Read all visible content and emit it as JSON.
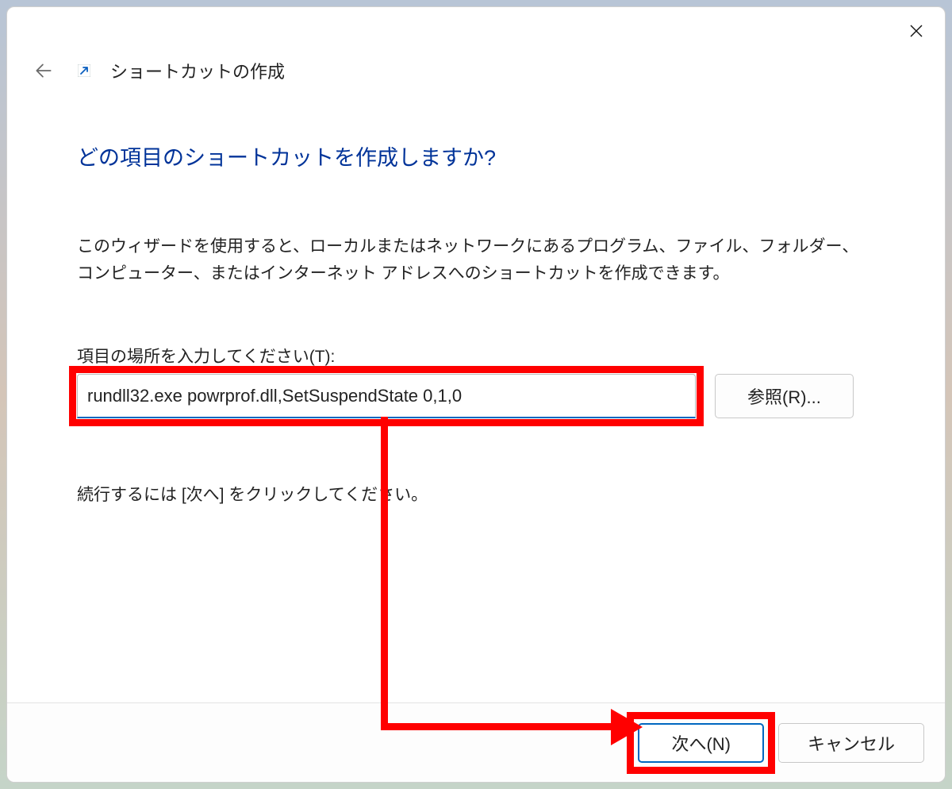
{
  "header": {
    "wizard_title": "ショートカットの作成"
  },
  "main": {
    "question": "どの項目のショートカットを作成しますか?",
    "description": "このウィザードを使用すると、ローカルまたはネットワークにあるプログラム、ファイル、フォルダー、コンピューター、またはインターネット アドレスへのショートカットを作成できます。",
    "field_label": "項目の場所を入力してください(T):",
    "location_value": "rundll32.exe powrprof.dll,SetSuspendState 0,1,0",
    "browse_label": "参照(R)...",
    "continue_text": "続行するには [次へ] をクリックしてください。"
  },
  "footer": {
    "next_label": "次へ(N)",
    "cancel_label": "キャンセル"
  }
}
